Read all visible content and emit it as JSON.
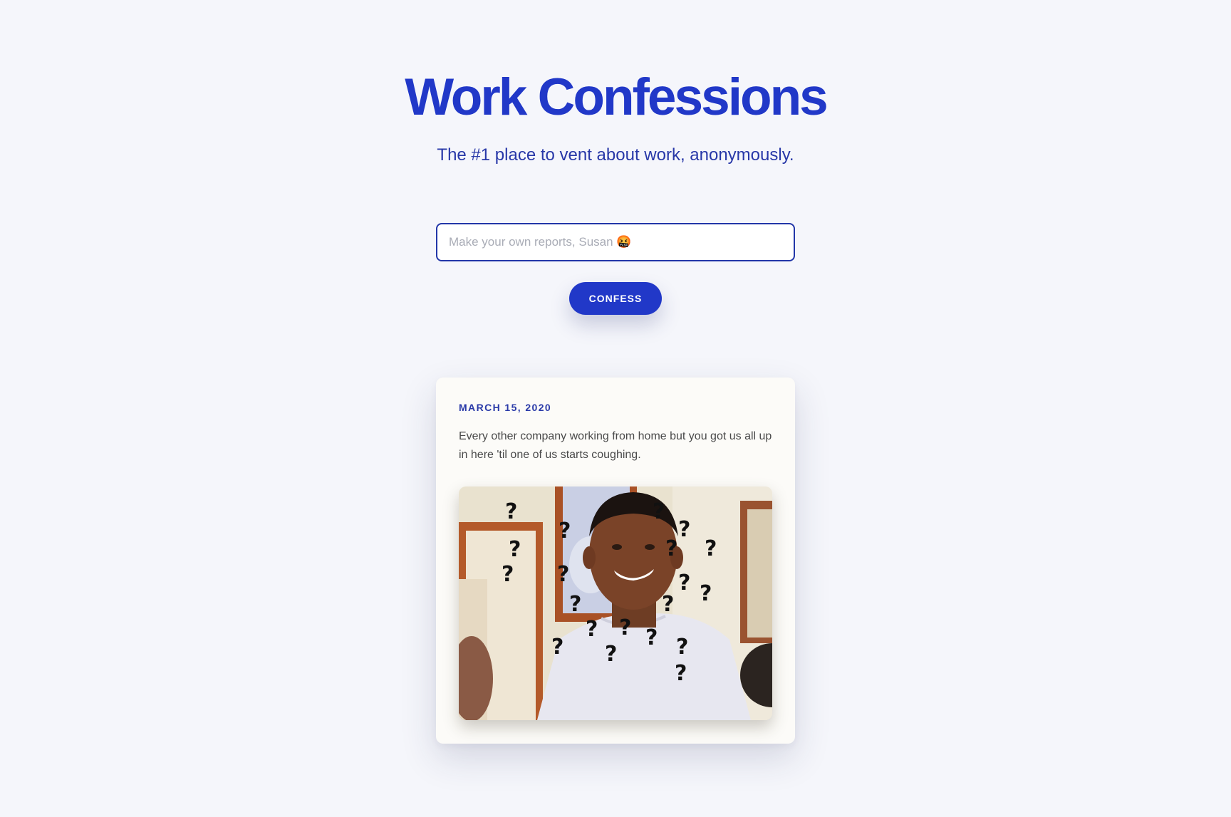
{
  "header": {
    "title": "Work Confessions",
    "subtitle": "The #1 place to vent about work, anonymously."
  },
  "form": {
    "placeholder": "Make your own reports, Susan 🤬",
    "value": "",
    "submit_label": "CONFESS"
  },
  "confessions": [
    {
      "date": "MARCH 15, 2020",
      "text": "Every other company working from home but you got us all up in here 'til one of us starts coughing.",
      "image": "confused-man-question-marks-meme"
    }
  ],
  "colors": {
    "accent": "#2138c8",
    "background": "#f5f6fb",
    "card": "#fcfbf8"
  }
}
